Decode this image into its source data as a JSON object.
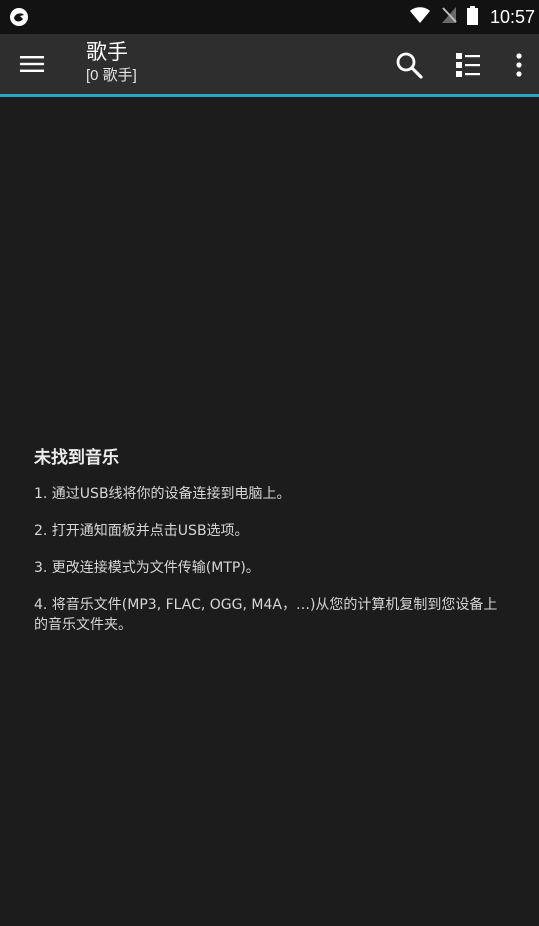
{
  "status_bar": {
    "time": "10:57",
    "icons": [
      "app-notification-icon",
      "wifi-icon",
      "no-signal-icon",
      "battery-icon"
    ]
  },
  "app_bar": {
    "title": "歌手",
    "subtitle": "[0 歌手]",
    "actions": [
      "search-icon",
      "list-view-icon",
      "more-options-icon"
    ],
    "accent_color": "#2aa6c4"
  },
  "empty_state": {
    "title": "未找到音乐",
    "steps": [
      "1. 通过USB线将你的设备连接到电脑上。",
      "2. 打开通知面板并点击USB选项。",
      "3. 更改连接模式为文件传输(MTP)。",
      "4. 将音乐文件(MP3, FLAC, OGG, M4A，…)从您的计算机复制到您设备上的音乐文件夹。"
    ]
  }
}
